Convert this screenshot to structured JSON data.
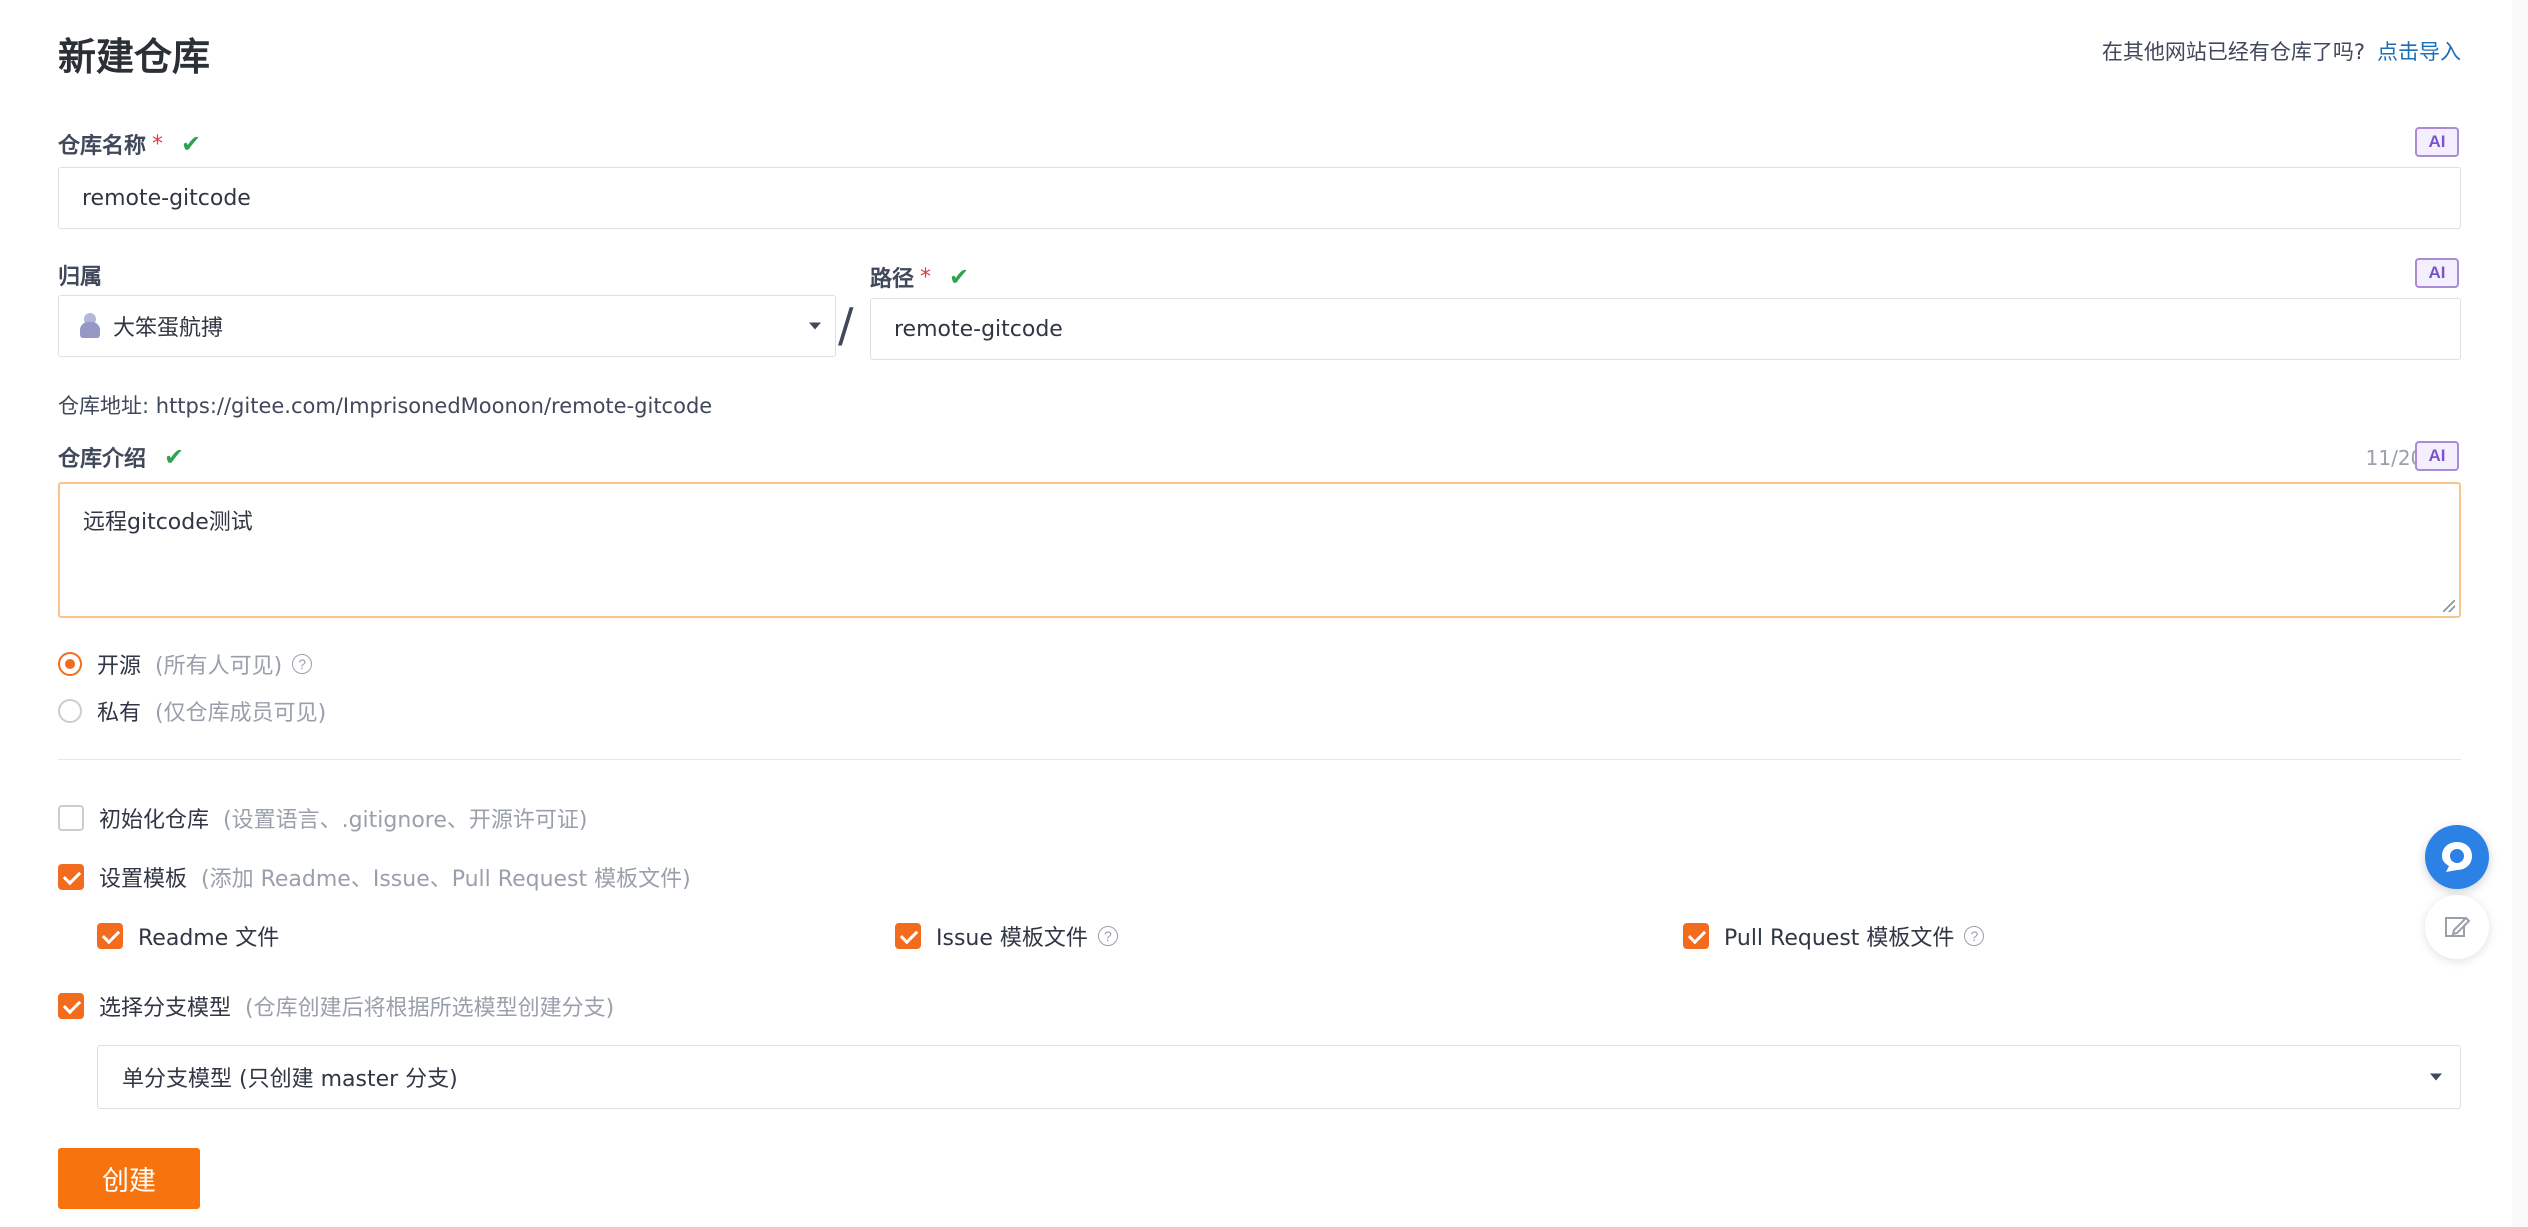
{
  "header": {
    "title": "新建仓库",
    "import_hint": "在其他网站已经有仓库了吗?",
    "import_link": "点击导入"
  },
  "repo_name": {
    "label": "仓库名称",
    "required_mark": "*",
    "value": "remote-gitcode",
    "ai_badge": "AI"
  },
  "owner": {
    "label": "归属",
    "value": "大笨蛋航搏"
  },
  "path": {
    "label": "路径",
    "required_mark": "*",
    "separator": "/",
    "value": "remote-gitcode",
    "ai_badge": "AI"
  },
  "repo_url": {
    "label": "仓库地址:",
    "value": "https://gitee.com/ImprisonedMoonon/remote-gitcode"
  },
  "description": {
    "label": "仓库介绍",
    "counter": "11/200",
    "value": "远程gitcode测试",
    "ai_badge": "AI"
  },
  "visibility": {
    "options": [
      {
        "label": "开源",
        "hint": "(所有人可见)",
        "selected": true
      },
      {
        "label": "私有",
        "hint": "(仅仓库成员可见)",
        "selected": false
      }
    ]
  },
  "options": {
    "init_repo": {
      "label": "初始化仓库",
      "hint": "(设置语言、.gitignore、开源许可证)",
      "checked": false
    },
    "set_template": {
      "label": "设置模板",
      "hint": "(添加 Readme、Issue、Pull Request 模板文件)",
      "checked": true
    },
    "templates": [
      {
        "label": "Readme 文件",
        "checked": true
      },
      {
        "label": "Issue 模板文件",
        "checked": true
      },
      {
        "label": "Pull Request 模板文件",
        "checked": true
      }
    ],
    "branch_model": {
      "label": "选择分支模型",
      "hint": "(仓库创建后将根据所选模型创建分支)",
      "checked": true
    },
    "branch_model_value": "单分支模型 (只创建 master 分支)"
  },
  "actions": {
    "create_label": "创建"
  },
  "colors": {
    "accent": "#f7730e",
    "link": "#1a6fb6",
    "valid": "#2ea44f",
    "required": "#e23b3b"
  }
}
